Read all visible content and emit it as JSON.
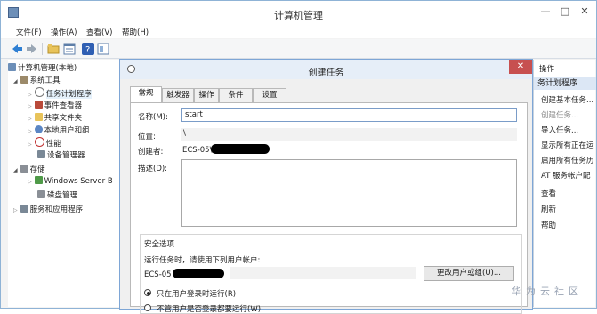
{
  "window": {
    "title": "计算机管理",
    "minimize_glyph": "—",
    "maximize_glyph": "□",
    "close_glyph": "✕"
  },
  "menubar": {
    "items": [
      "文件(F)",
      "操作(A)",
      "查看(V)",
      "帮助(H)"
    ]
  },
  "toolbar": {
    "buttons": [
      "back-arrow-icon",
      "forward-arrow-icon",
      "folder-icon",
      "properties-icon",
      "help-icon",
      "console-icon"
    ]
  },
  "tree": {
    "root": "计算机管理(本地)",
    "items": [
      {
        "label": "系统工具",
        "expand": "◢"
      },
      {
        "label": "任务计划程序",
        "expand": "▷",
        "selected": true
      },
      {
        "label": "事件查看器",
        "expand": "▷"
      },
      {
        "label": "共享文件夹",
        "expand": "▷"
      },
      {
        "label": "本地用户和组",
        "expand": "▷"
      },
      {
        "label": "性能",
        "expand": "▷"
      },
      {
        "label": "设备管理器",
        "expand": ""
      },
      {
        "label": "存储",
        "expand": "◢"
      },
      {
        "label": "Windows Server B",
        "expand": "▷"
      },
      {
        "label": "磁盘管理",
        "expand": ""
      },
      {
        "label": "服务和应用程序",
        "expand": "▷"
      }
    ]
  },
  "actions": {
    "header": "操作",
    "section": "务计划程序",
    "items": [
      "创建基本任务...",
      "创建任务...",
      "导入任务...",
      "显示所有正在运",
      "启用所有任务历",
      "AT 服务帐户配",
      "查看",
      "刷新",
      "帮助"
    ]
  },
  "dialog": {
    "title": "创建任务",
    "close_glyph": "✕",
    "tabs": [
      "常规",
      "触发器",
      "操作",
      "条件",
      "设置"
    ],
    "name_label": "名称(M):",
    "name_value": "start",
    "location_label": "位置:",
    "location_value": "\\",
    "author_label": "创建者:",
    "author_value": "ECS-05\\",
    "description_label": "描述(D):",
    "security": {
      "title": "安全选项",
      "run_as_label": "运行任务时，请使用下列用户帐户:",
      "account_value": "ECS-05",
      "change_button": "更改用户或组(U)...",
      "radio_logged_on": "只在用户登录时运行(R)",
      "radio_whether": "不管用户是否登录都要运行(W)"
    }
  },
  "watermark": "华为云社区",
  "colors": {
    "accent": "#7ea6d6",
    "close_red": "#c75050",
    "selection": "#e5f1fb"
  }
}
